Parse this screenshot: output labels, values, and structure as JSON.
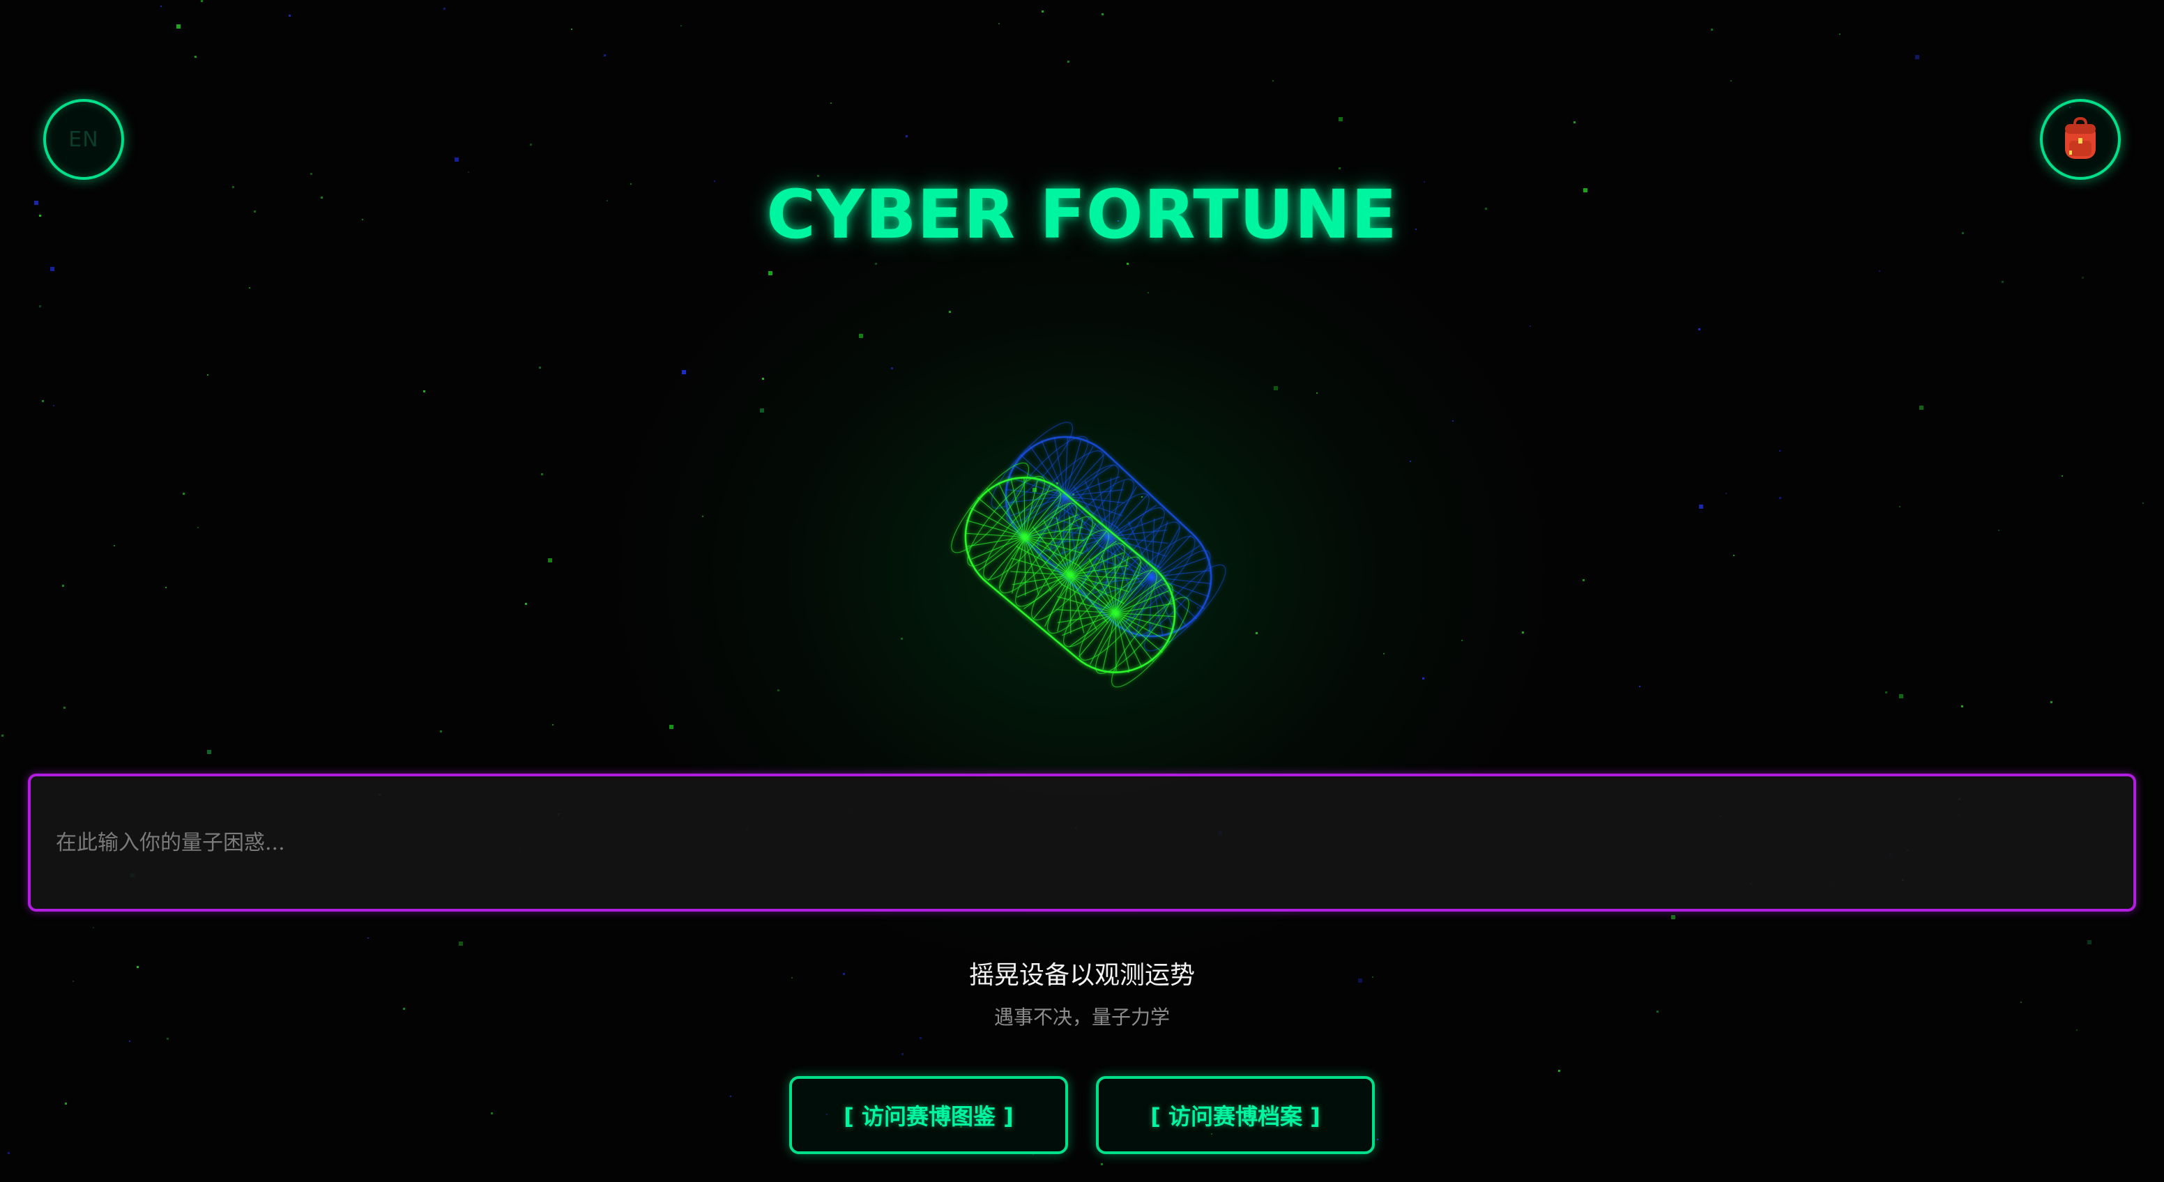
{
  "language_toggle": {
    "label": "EN"
  },
  "inventory": {
    "icon": "backpack-icon"
  },
  "header": {
    "title": "CYBER FORTUNE"
  },
  "dice": {
    "icon": "wireframe-dice-icon",
    "colors": [
      "#2bff2b",
      "#1a55ff"
    ]
  },
  "question": {
    "placeholder": "在此输入你的量子困惑..."
  },
  "instructions": {
    "primary": "摇晃设备以观测运势",
    "secondary": "遇事不决，量子力学"
  },
  "nav": {
    "gallery_label": "[ 访问赛博图鉴 ]",
    "archive_label": "[ 访问赛博档案 ]"
  },
  "colors": {
    "accent": "#00f5a0",
    "input_border": "#b21ee0",
    "background": "#030303"
  }
}
